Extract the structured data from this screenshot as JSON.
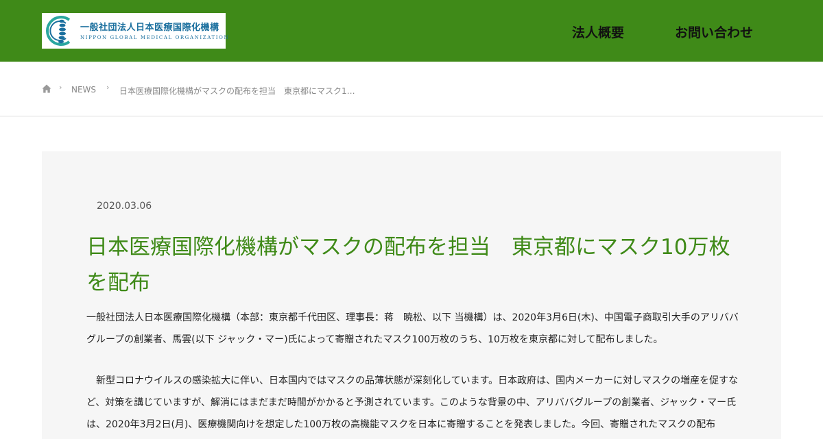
{
  "header": {
    "logo": {
      "name_jp": "一般社団法人日本医療国際化機構",
      "name_en": "NIPPON GLOBAL MEDICAL ORGANIZATION"
    },
    "nav": [
      "法人概要",
      "お問い合わせ"
    ]
  },
  "breadcrumb": {
    "home_icon": "home-icon",
    "section": "NEWS",
    "current": "日本医療国際化機構がマスクの配布を担当　東京都にマスク1…"
  },
  "article": {
    "date": "2020.03.06",
    "title": "日本医療国際化機構がマスクの配布を担当　東京都にマスク10万枚を配布",
    "paragraphs": [
      "一般社団法人日本医療国際化機構（本部：東京都千代田区、理事長：蒋　暁松、以下 当機構）は、2020年3月6日(木)、中国電子商取引大手のアリババグループの創業者、馬雲(以下 ジャック・マー)氏によって寄贈されたマスク100万枚のうち、10万枚を東京都に対して配布しました。",
      "新型コロナウイルスの感染拡大に伴い、日本国内ではマスクの品薄状態が深刻化しています。日本政府は、国内メーカーに対しマスクの増産を促すなど、対策を講じていますが、解消にはまだまだ時間がかかると予測されています。このような背景の中、アリババグループの創業者、ジャック・マー氏は、2020年3月2日(月)、医療機関向けを想定した100万枚の高機能マスクを日本に寄贈することを発表しました。今回、寄贈されたマスクの配布"
    ]
  },
  "colors": {
    "header_bg": "#3f8a18",
    "title": "#3f8a18",
    "logo_text": "#1a6f9e",
    "article_bg": "#f6f6f6"
  }
}
